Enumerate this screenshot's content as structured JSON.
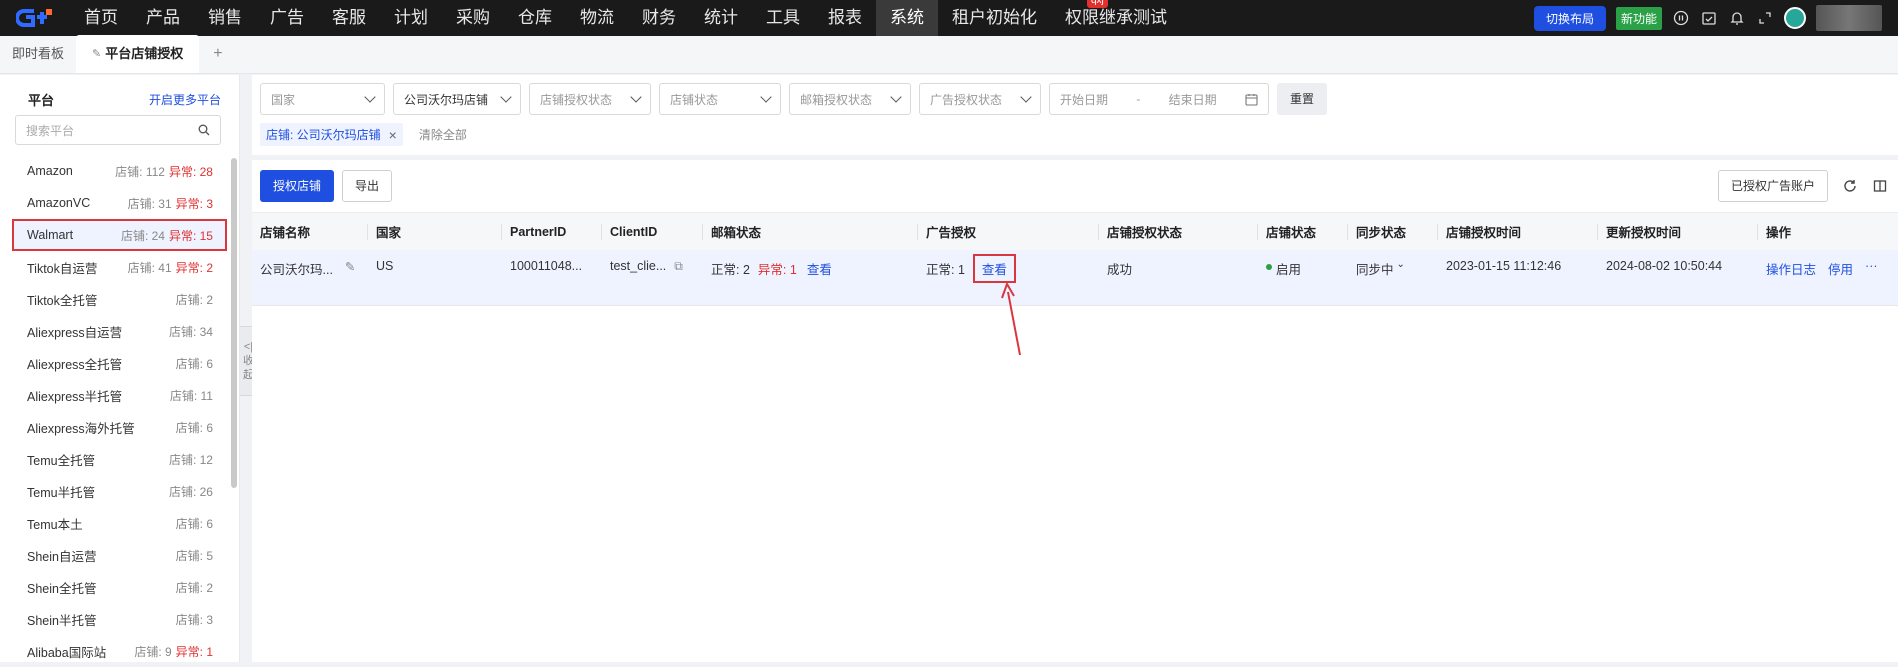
{
  "topnav": {
    "items": [
      "首页",
      "产品",
      "销售",
      "广告",
      "客服",
      "计划",
      "采购",
      "仓库",
      "物流",
      "财务",
      "统计",
      "工具",
      "报表",
      "系统",
      "租户初始化",
      "权限继承测试"
    ],
    "active_index": 13,
    "badge": "qxj",
    "switch_layout": "切换布局",
    "new_feature": "新功能"
  },
  "tabs": {
    "dashboard": "即时看板",
    "active": "平台店铺授权",
    "add": "+"
  },
  "sidebar": {
    "title": "平台",
    "enable_more": "开启更多平台",
    "search_placeholder": "搜索平台",
    "items": [
      {
        "name": "Amazon",
        "count": "店铺: 112",
        "abnormal": "异常: 28"
      },
      {
        "name": "AmazonVC",
        "count": "店铺: 31",
        "abnormal": "异常: 3"
      },
      {
        "name": "Walmart",
        "count": "店铺: 24",
        "abnormal": "异常: 15"
      },
      {
        "name": "Tiktok自运营",
        "count": "店铺: 41",
        "abnormal": "异常: 2"
      },
      {
        "name": "Tiktok全托管",
        "count": "店铺: 2",
        "abnormal": ""
      },
      {
        "name": "Aliexpress自运营",
        "count": "店铺: 34",
        "abnormal": ""
      },
      {
        "name": "Aliexpress全托管",
        "count": "店铺: 6",
        "abnormal": ""
      },
      {
        "name": "Aliexpress半托管",
        "count": "店铺: 11",
        "abnormal": ""
      },
      {
        "name": "Aliexpress海外托管",
        "count": "店铺: 6",
        "abnormal": ""
      },
      {
        "name": "Temu全托管",
        "count": "店铺: 12",
        "abnormal": ""
      },
      {
        "name": "Temu半托管",
        "count": "店铺: 26",
        "abnormal": ""
      },
      {
        "name": "Temu本土",
        "count": "店铺: 6",
        "abnormal": ""
      },
      {
        "name": "Shein自运营",
        "count": "店铺: 5",
        "abnormal": ""
      },
      {
        "name": "Shein全托管",
        "count": "店铺: 2",
        "abnormal": ""
      },
      {
        "name": "Shein半托管",
        "count": "店铺: 3",
        "abnormal": ""
      },
      {
        "name": "Alibaba国际站",
        "count": "店铺: 9",
        "abnormal": "异常: 1"
      }
    ],
    "selected_index": 2,
    "collapse_label": [
      "<|",
      "收",
      "起"
    ]
  },
  "filters": {
    "country": "国家",
    "store": "公司沃尔玛店铺",
    "store_auth_status": "店铺授权状态",
    "store_status": "店铺状态",
    "email_auth_status": "邮箱授权状态",
    "ad_auth_status": "广告授权状态",
    "start_date": "开始日期",
    "date_sep": "-",
    "end_date": "结束日期",
    "reset": "重置",
    "tag_label": "店铺: 公司沃尔玛店铺",
    "clear_all": "清除全部"
  },
  "toolbar": {
    "authorize": "授权店铺",
    "export": "导出",
    "authorized_ad_accounts": "已授权广告账户"
  },
  "table": {
    "columns": [
      "店铺名称",
      "国家",
      "PartnerID",
      "ClientID",
      "邮箱状态",
      "广告授权",
      "店铺授权状态",
      "店铺状态",
      "同步状态",
      "店铺授权时间",
      "更新授权时间",
      "操作"
    ],
    "row": {
      "store_name": "公司沃尔玛...",
      "country": "US",
      "partner_id": "100011048...",
      "client_id": "test_clie...",
      "email_normal": "正常: 2",
      "email_abnormal": "异常: 1",
      "email_view": "查看",
      "ad_normal": "正常: 1",
      "ad_view": "查看",
      "store_auth_status": "成功",
      "store_status": "启用",
      "sync_status": "同步中",
      "auth_time": "2023-01-15 11:12:46",
      "update_time": "2024-08-02 10:50:44",
      "op_log": "操作日志",
      "op_disable": "停用",
      "op_more": "···"
    }
  }
}
